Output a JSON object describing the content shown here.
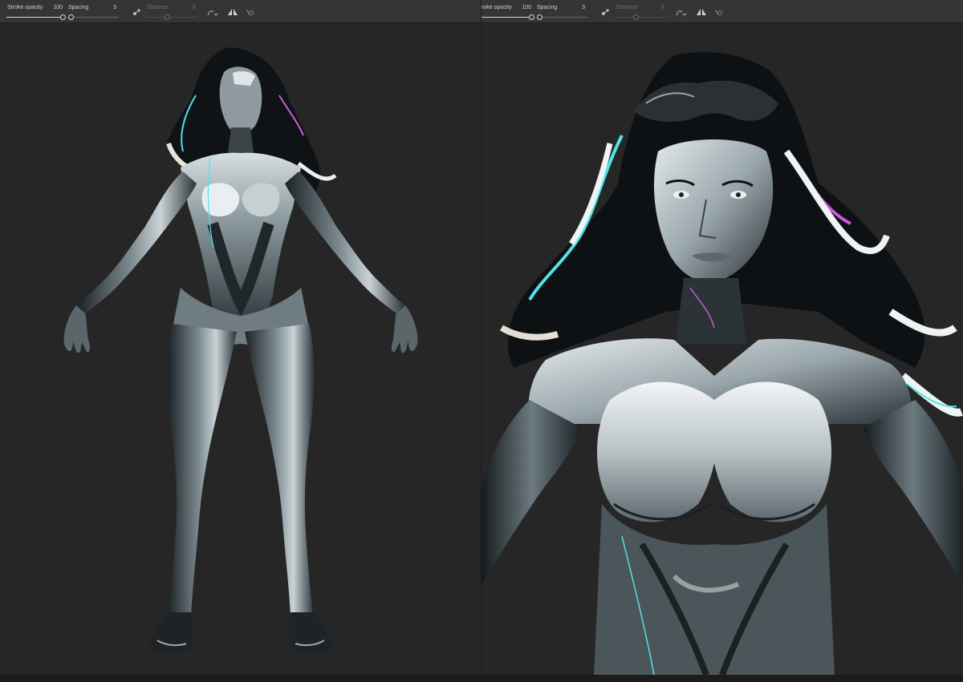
{
  "panels": [
    {
      "toolbar": {
        "stroke_opacity_label": "Stroke opacity",
        "stroke_opacity_value": "100",
        "stroke_opacity_fraction": 1.0,
        "spacing_label": "Spacing",
        "spacing_value": "3",
        "spacing_fraction": 0.03,
        "distance_label": "Distance",
        "distance_value": "8",
        "distance_fraction": 0.4,
        "icons": [
          "brush-pressure-icon",
          "curve-dropdown-icon",
          "symmetry-icon",
          "settings-icon"
        ]
      },
      "canvas": {
        "content": "full-body-figure"
      }
    },
    {
      "toolbar": {
        "stroke_opacity_label": "roke opacity",
        "stroke_opacity_value": "100",
        "stroke_opacity_fraction": 1.0,
        "spacing_label": "Spacing",
        "spacing_value": "3",
        "spacing_fraction": 0.03,
        "distance_label": "Distance",
        "distance_value": "8",
        "distance_fraction": 0.4,
        "icons": [
          "brush-pressure-icon",
          "curve-dropdown-icon",
          "symmetry-icon",
          "settings-icon"
        ]
      },
      "canvas": {
        "content": "close-up-figure"
      }
    }
  ],
  "colors": {
    "background": "#262626",
    "toolbar": "#353535",
    "figure_dark": "#1e2326",
    "figure_mid": "#5e6a70",
    "figure_light": "#c9d3d6",
    "highlight": "#f4f7f7",
    "accent_cyan": "#4fe3e8",
    "accent_magenta": "#c85cd6"
  }
}
